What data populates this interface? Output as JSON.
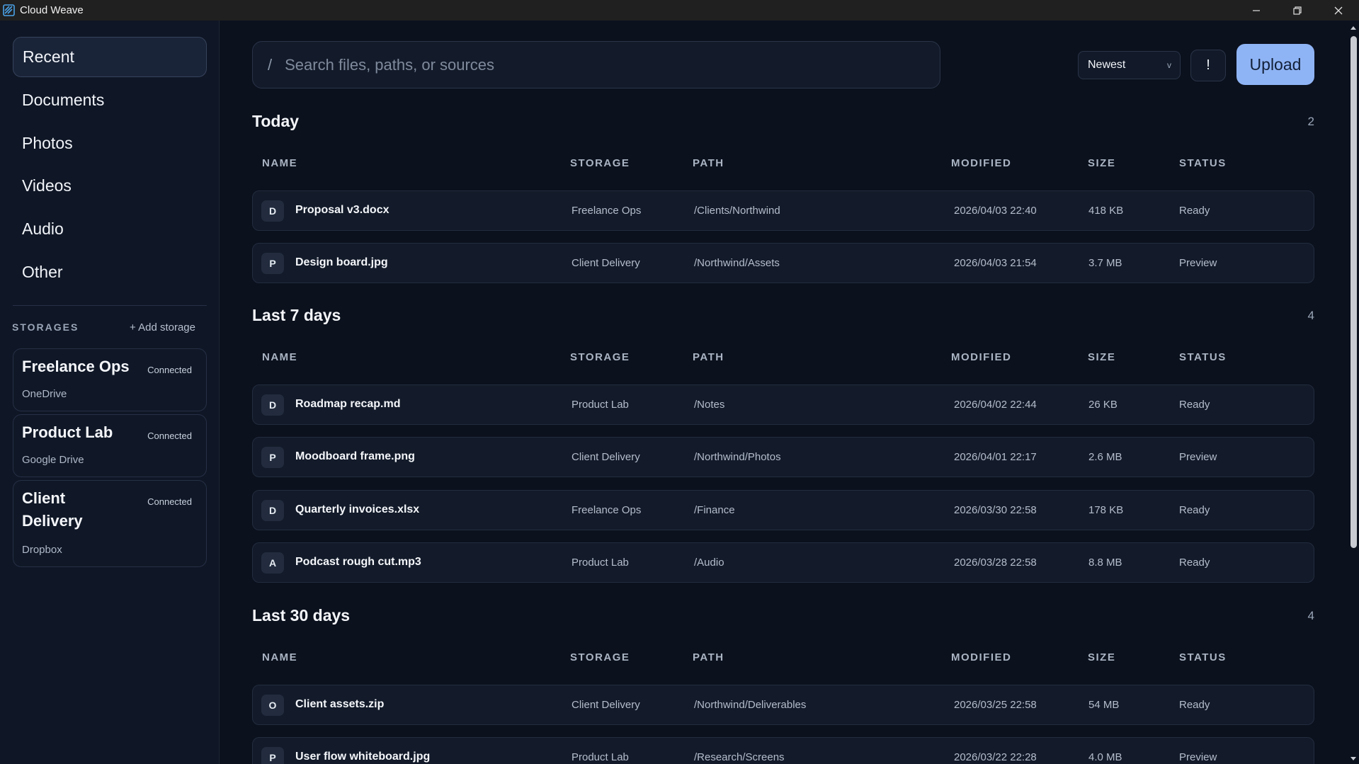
{
  "window": {
    "title": "Cloud Weave",
    "controls": [
      "minimize-icon",
      "restore-icon",
      "close-icon"
    ]
  },
  "sidebar": {
    "nav": [
      {
        "label": "Recent",
        "active": true
      },
      {
        "label": "Documents"
      },
      {
        "label": "Photos"
      },
      {
        "label": "Videos"
      },
      {
        "label": "Audio"
      },
      {
        "label": "Other"
      }
    ],
    "storages_label": "STORAGES",
    "add_storage": "+ Add storage",
    "storages": [
      {
        "name": "Freelance Ops",
        "provider": "OneDrive",
        "status": "Connected"
      },
      {
        "name": "Product Lab",
        "provider": "Google Drive",
        "status": "Connected"
      },
      {
        "name_line1": "Client",
        "name_line2": "Delivery",
        "provider": "Dropbox",
        "status": "Connected"
      }
    ]
  },
  "toolbar": {
    "search_slash": "/",
    "search_placeholder": "Search files, paths, or sources",
    "search_value": "",
    "sort_value": "Newest",
    "sort_caret": "v",
    "alert_label": "!",
    "upload_label": "Upload"
  },
  "columns": {
    "name": "NAME",
    "storage": "STORAGE",
    "path": "PATH",
    "modified": "MODIFIED",
    "size": "SIZE",
    "status": "STATUS"
  },
  "groups": [
    {
      "title": "Today",
      "count": "2",
      "files": [
        {
          "type": "D",
          "name": "Proposal v3.docx",
          "storage": "Freelance Ops",
          "path": "/Clients/Northwind",
          "modified": "2026/04/03 22:40",
          "size": "418 KB",
          "status": "Ready"
        },
        {
          "type": "P",
          "name": "Design board.jpg",
          "storage": "Client Delivery",
          "path": "/Northwind/Assets",
          "modified": "2026/04/03 21:54",
          "size": "3.7 MB",
          "status": "Preview"
        }
      ]
    },
    {
      "title": "Last 7 days",
      "count": "4",
      "files": [
        {
          "type": "D",
          "name": "Roadmap recap.md",
          "storage": "Product Lab",
          "path": "/Notes",
          "modified": "2026/04/02 22:44",
          "size": "26 KB",
          "status": "Ready"
        },
        {
          "type": "P",
          "name": "Moodboard frame.png",
          "storage": "Client Delivery",
          "path": "/Northwind/Photos",
          "modified": "2026/04/01 22:17",
          "size": "2.6 MB",
          "status": "Preview"
        },
        {
          "type": "D",
          "name": "Quarterly invoices.xlsx",
          "storage": "Freelance Ops",
          "path": "/Finance",
          "modified": "2026/03/30 22:58",
          "size": "178 KB",
          "status": "Ready"
        },
        {
          "type": "A",
          "name": "Podcast rough cut.mp3",
          "storage": "Product Lab",
          "path": "/Audio",
          "modified": "2026/03/28 22:58",
          "size": "8.8 MB",
          "status": "Ready"
        }
      ]
    },
    {
      "title": "Last 30 days",
      "count": "4",
      "files": [
        {
          "type": "O",
          "name": "Client assets.zip",
          "storage": "Client Delivery",
          "path": "/Northwind/Deliverables",
          "modified": "2026/03/25 22:58",
          "size": "54 MB",
          "status": "Ready"
        },
        {
          "type": "P",
          "name": "User flow whiteboard.jpg",
          "storage": "Product Lab",
          "path": "/Research/Screens",
          "modified": "2026/03/22 22:28",
          "size": "4.0 MB",
          "status": "Preview"
        }
      ]
    }
  ]
}
